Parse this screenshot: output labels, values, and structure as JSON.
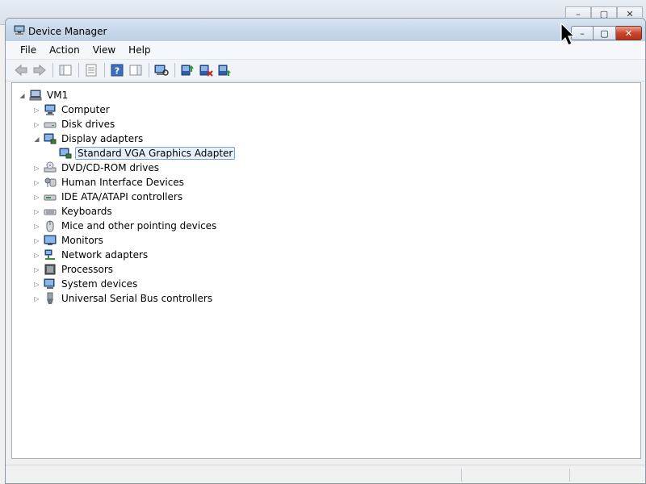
{
  "back_window": {
    "controls": [
      "–",
      "▢",
      "✕"
    ]
  },
  "window": {
    "title": "Device Manager",
    "controls": {
      "minimize": "–",
      "maximize": "▢",
      "close": "✕"
    }
  },
  "menu": {
    "items": [
      "File",
      "Action",
      "View",
      "Help"
    ]
  },
  "toolbar": {
    "buttons": [
      {
        "name": "back-arrow-icon"
      },
      {
        "name": "forward-arrow-icon"
      },
      {
        "name": "show-hide-console-tree-icon"
      },
      {
        "name": "properties-icon"
      },
      {
        "name": "help-icon"
      },
      {
        "name": "action-pane-icon"
      },
      {
        "name": "scan-hardware-changes-icon"
      },
      {
        "name": "update-driver-icon"
      },
      {
        "name": "disable-device-icon"
      },
      {
        "name": "enable-device-icon"
      }
    ]
  },
  "tree": {
    "root": "VM1",
    "categories": [
      {
        "label": "Computer",
        "icon": "computer-icon",
        "expanded": false
      },
      {
        "label": "Disk drives",
        "icon": "disk-drive-icon",
        "expanded": false
      },
      {
        "label": "Display adapters",
        "icon": "display-adapter-icon",
        "expanded": true,
        "children": [
          {
            "label": "Standard VGA Graphics Adapter",
            "icon": "display-adapter-icon",
            "selected": true
          }
        ]
      },
      {
        "label": "DVD/CD-ROM drives",
        "icon": "dvd-drive-icon",
        "expanded": false
      },
      {
        "label": "Human Interface Devices",
        "icon": "hid-icon",
        "expanded": false
      },
      {
        "label": "IDE ATA/ATAPI controllers",
        "icon": "ide-controller-icon",
        "expanded": false
      },
      {
        "label": "Keyboards",
        "icon": "keyboard-icon",
        "expanded": false
      },
      {
        "label": "Mice and other pointing devices",
        "icon": "mouse-icon",
        "expanded": false
      },
      {
        "label": "Monitors",
        "icon": "monitor-icon",
        "expanded": false
      },
      {
        "label": "Network adapters",
        "icon": "network-adapter-icon",
        "expanded": false
      },
      {
        "label": "Processors",
        "icon": "processor-icon",
        "expanded": false
      },
      {
        "label": "System devices",
        "icon": "system-devices-icon",
        "expanded": false
      },
      {
        "label": "Universal Serial Bus controllers",
        "icon": "usb-controller-icon",
        "expanded": false
      }
    ]
  },
  "colors": {
    "titlebar": "#c8d8ea",
    "close_button": "#c9462c",
    "selection_border": "#7da2ce",
    "selection_fill": "#e8f1fb"
  }
}
